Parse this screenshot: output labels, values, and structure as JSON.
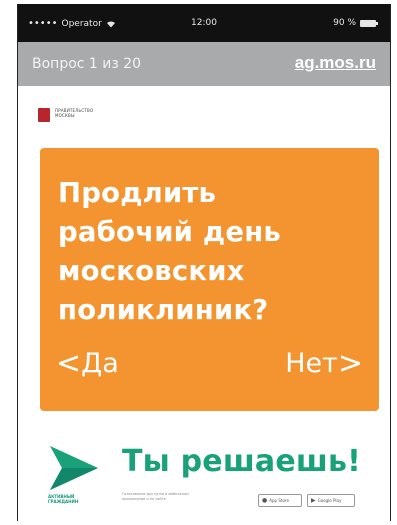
{
  "status_bar": {
    "carrier": "Operator",
    "signal_dots": "•••••",
    "time": "12:00",
    "battery_percent": "90 %"
  },
  "nav": {
    "progress": "Вопрос 1 из 20",
    "link": "ag.mos.ru"
  },
  "gov_logo": {
    "line1": "ПРАВИТЕЛЬСТВО",
    "line2": "МОСКВЫ"
  },
  "question": {
    "line1": "Продлить",
    "line2": "рабочий день",
    "line3": "московских",
    "line4": "поликлиник?"
  },
  "answers": {
    "yes_chevron": "<",
    "yes": "Да",
    "no": "Нет",
    "no_chevron": ">"
  },
  "footer": {
    "brand_line1": "АКТИВНЫЙ",
    "brand_line2": "ГРАЖДАНИН",
    "slogan": "Ты решаешь!",
    "small_text_line1": "Голосование доступно в мобильном",
    "small_text_line2": "приложении и на сайте",
    "app_store": "App Store",
    "google_play": "Google Play"
  },
  "colors": {
    "card": "#f39430",
    "nav_bar": "#a9aaab",
    "brand_green": "#19a179",
    "status_bar": "#111111"
  }
}
